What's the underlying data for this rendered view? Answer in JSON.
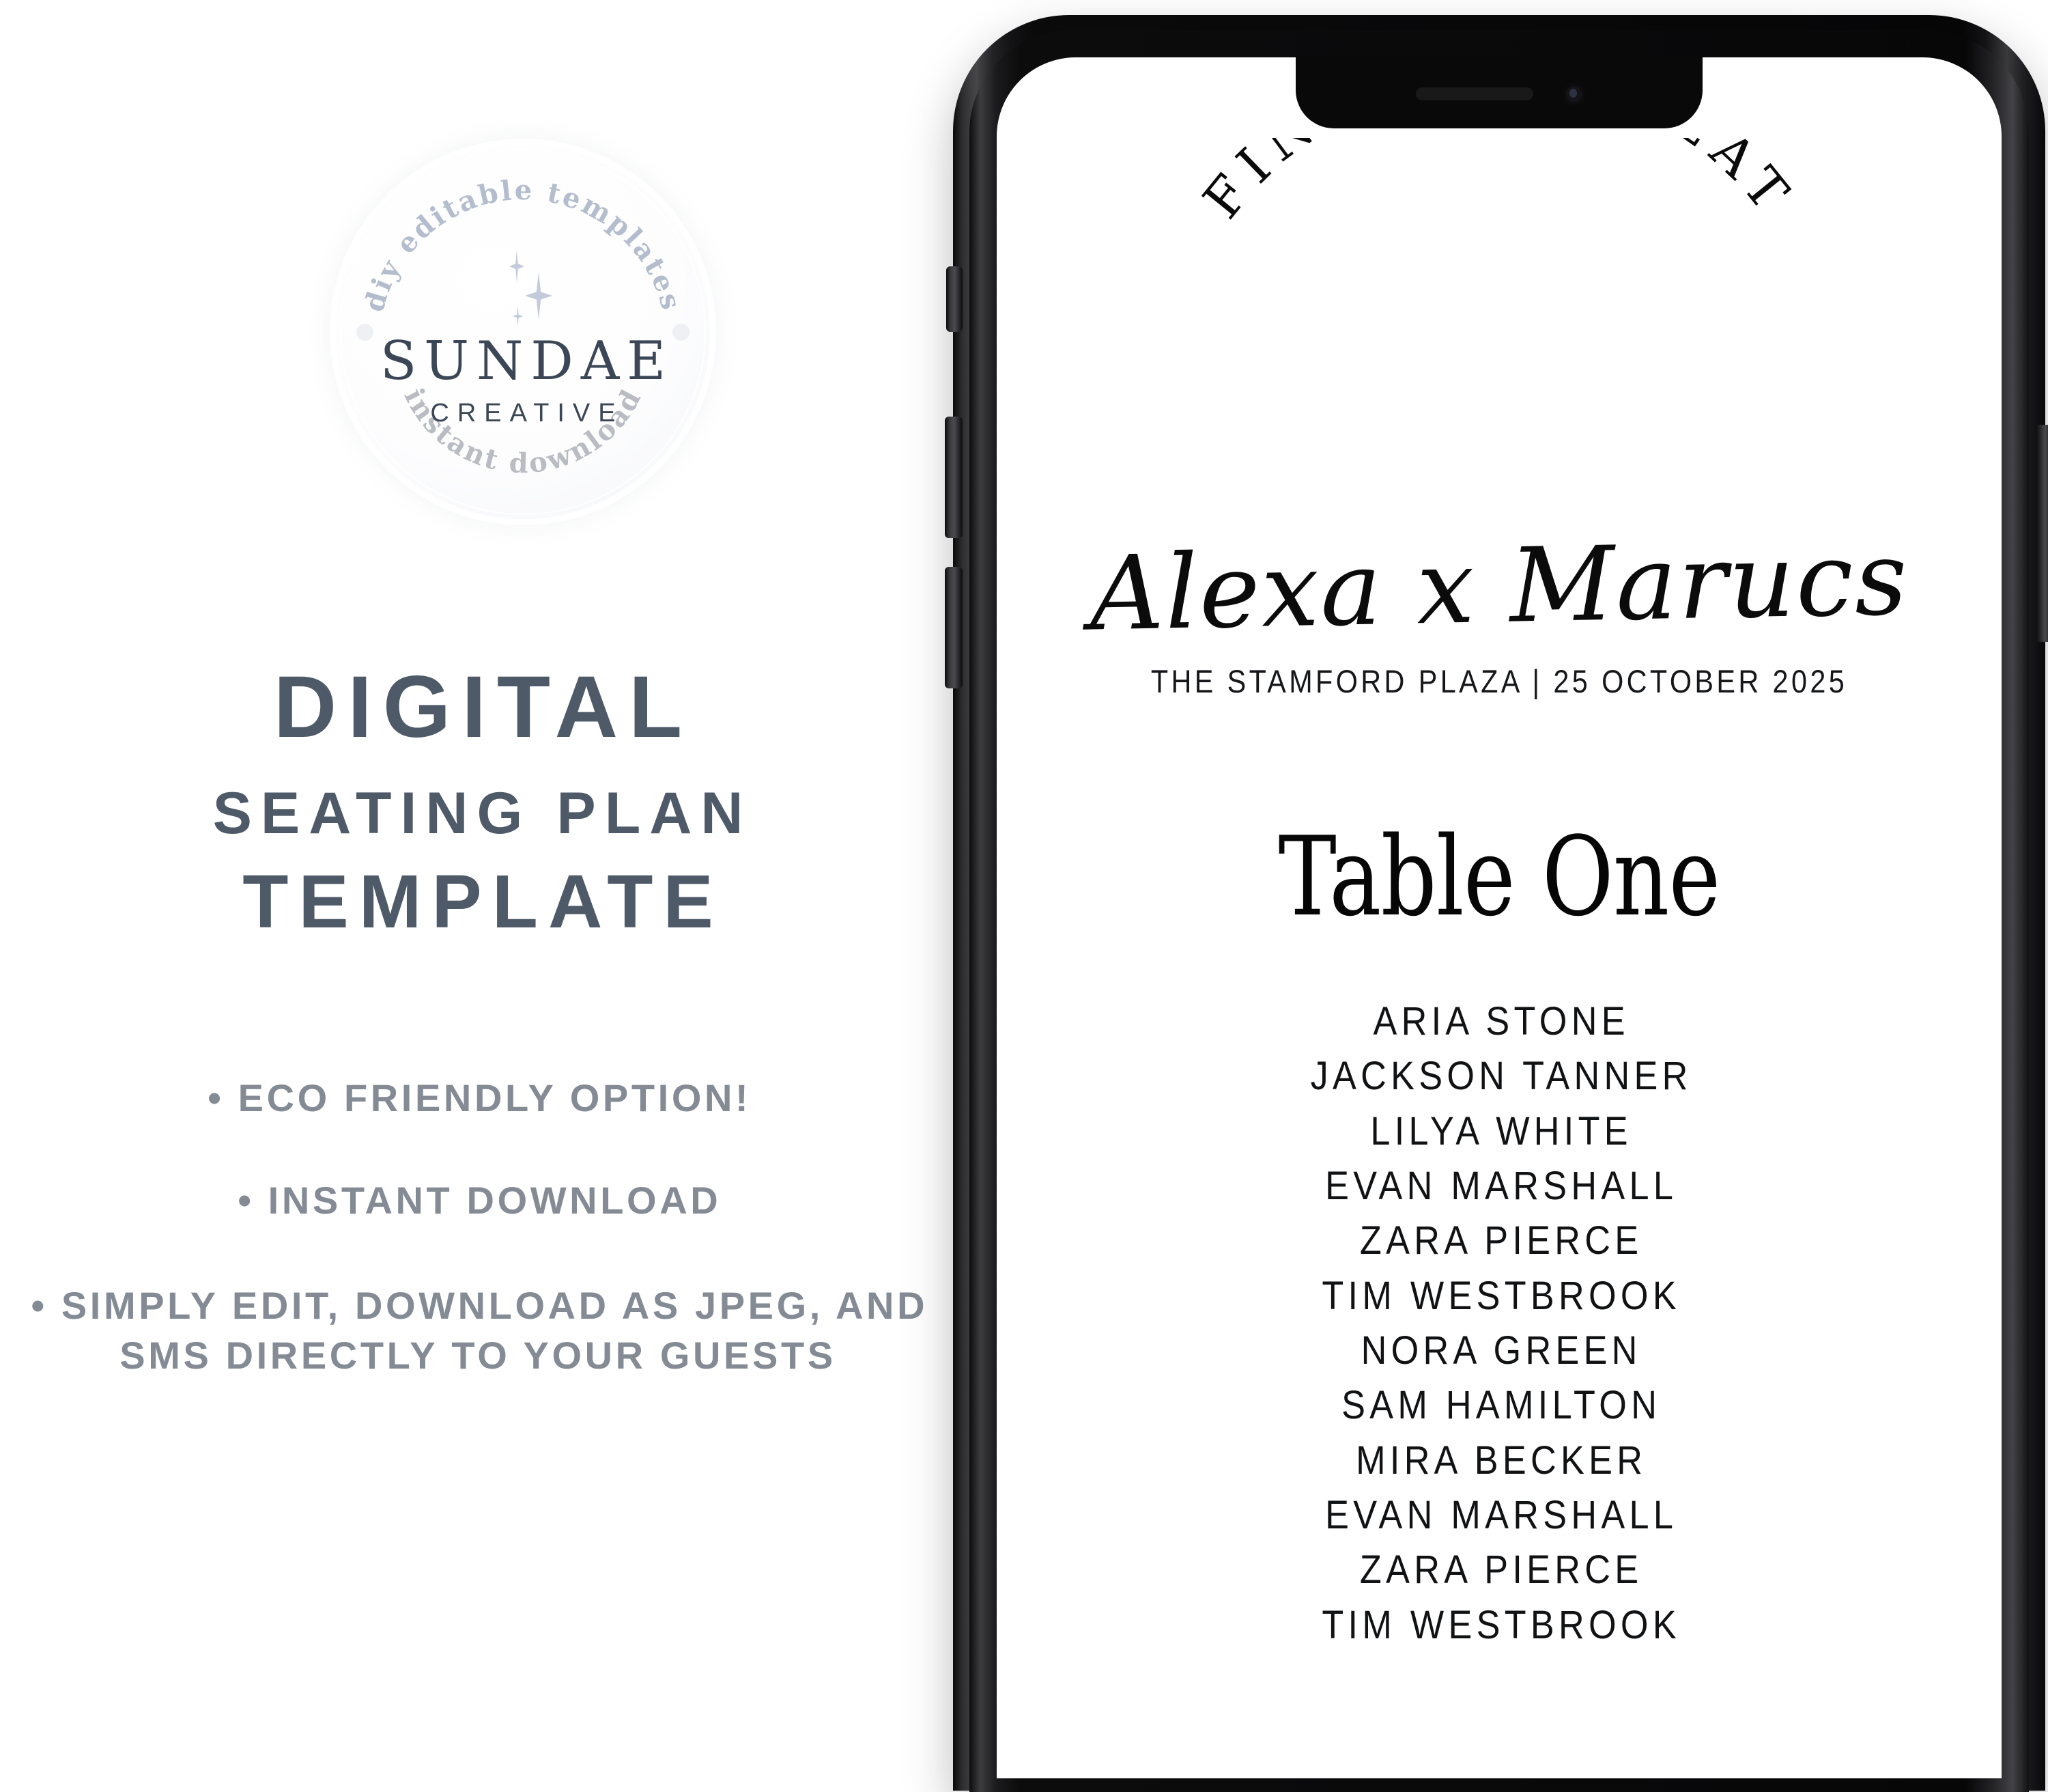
{
  "brand_seal": {
    "arc_top": "diy editable templates",
    "arc_bottom": "instant download",
    "name": "SUNDAE",
    "tagline": "CREATIVE",
    "icon": "sparkle-icon",
    "colors": {
      "arc_top_color": "#b3bdcd",
      "arc_bottom_color": "#b9bcc2",
      "brand_color": "#3b4656",
      "sparkle_color": "#c3cbda"
    }
  },
  "headline": {
    "line1": "DIGITAL",
    "line2": "SEATING PLAN",
    "line3": "TEMPLATE",
    "color": "#4e5a68"
  },
  "bullets": {
    "color": "#848b95",
    "items": [
      "• ECO FRIENDLY OPTION!",
      "• INSTANT DOWNLOAD",
      "• SIMPLY EDIT, DOWNLOAD AS JPEG, AND SMS DIRECTLY TO YOUR GUESTS"
    ]
  },
  "phone": {
    "frame_color": "#0a0a0b",
    "screen_background": "#ffffff",
    "side_buttons": [
      "mute-switch",
      "volume-up",
      "volume-down",
      "power"
    ],
    "notch_elements": [
      "earpiece-speaker",
      "front-camera"
    ]
  },
  "seating_card": {
    "arched_title": "FIND YOUR SEAT",
    "couple_names": "Alexa x Marucs",
    "venue_date": "THE STAMFORD PLAZA | 25 OCTOBER 2025",
    "table_name": "Table One",
    "guests": [
      "ARIA STONE",
      "JACKSON TANNER",
      "LILYA WHITE",
      "EVAN MARSHALL",
      "ZARA PIERCE",
      "TIM WESTBROOK",
      "NORA GREEN",
      "SAM HAMILTON",
      "MIRA BECKER",
      "EVAN MARSHALL",
      "ZARA PIERCE",
      "TIM WESTBROOK"
    ],
    "text_color": "#0a0a0a"
  }
}
